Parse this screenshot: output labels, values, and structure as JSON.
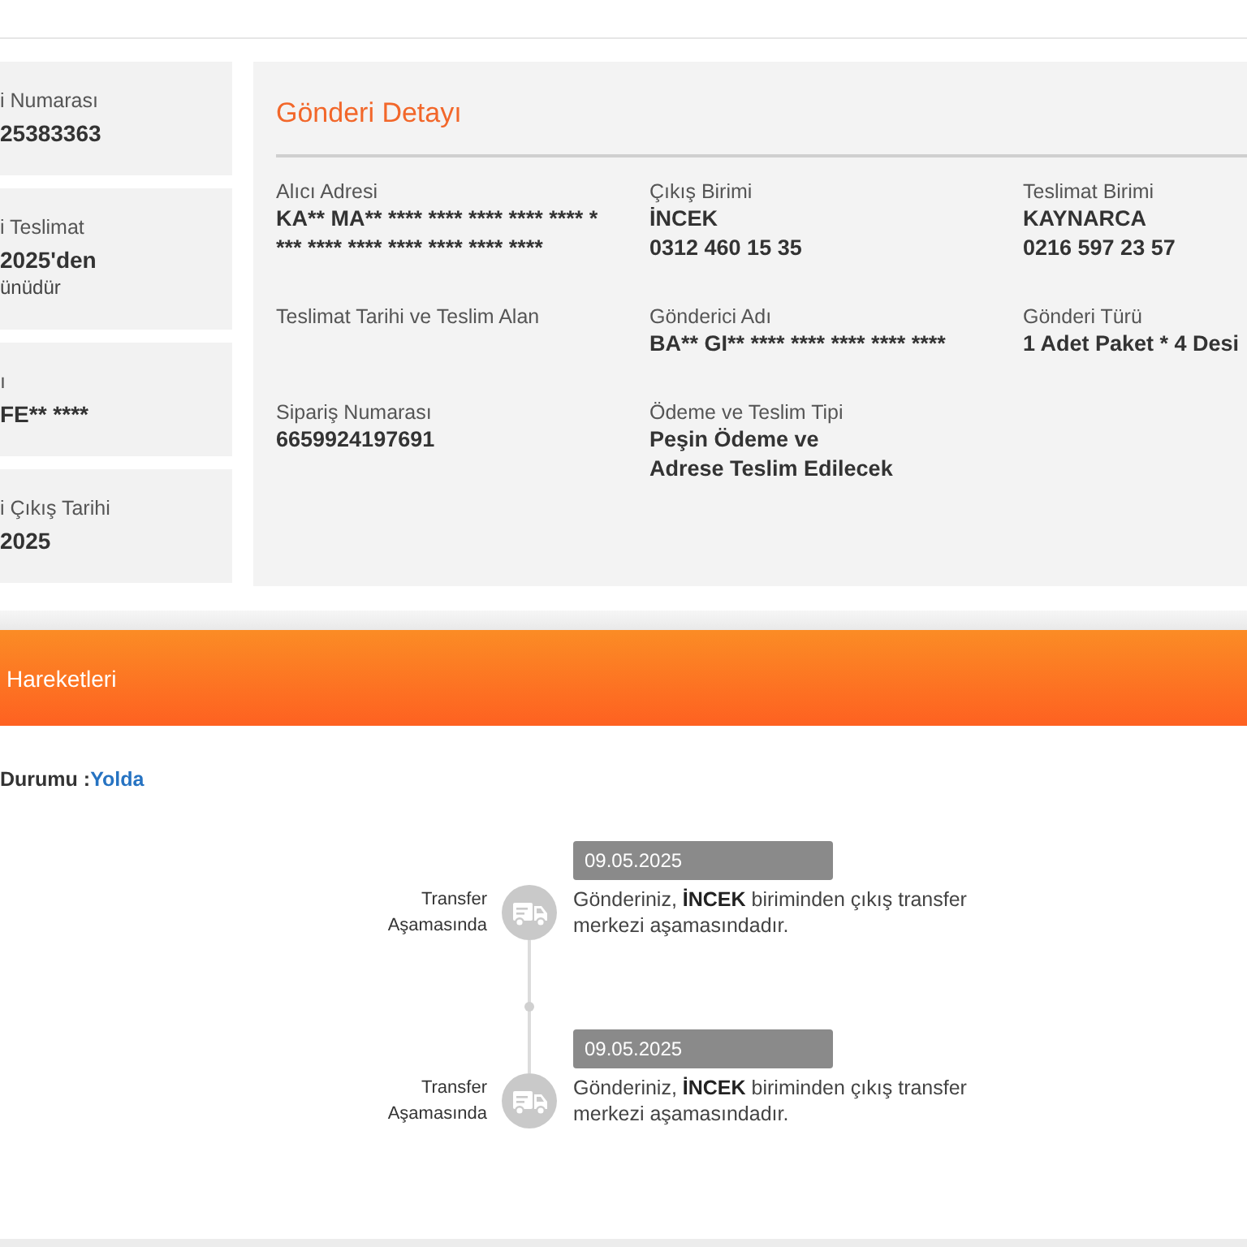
{
  "summary_cards": [
    {
      "label": "i Numarası",
      "value": "25383363"
    },
    {
      "label": "i Teslimat",
      "value": "2025'den",
      "note": "ünüdür"
    },
    {
      "label": "ı",
      "value": "FE** ****"
    },
    {
      "label": "i Çıkış Tarihi",
      "value": "2025"
    }
  ],
  "shipment_detail": {
    "title": "Gönderi Detayı",
    "fields": [
      {
        "label": "Alıcı Adresi",
        "value_lines": [
          "KA** MA** **** **** **** **** **** *",
          "*** **** **** **** **** **** ****"
        ]
      },
      {
        "label": "Çıkış Birimi",
        "value_lines": [
          "İNCEK",
          "0312 460 15 35"
        ]
      },
      {
        "label": "Teslimat Birimi",
        "value_lines": [
          "KAYNARCA",
          "0216 597 23 57"
        ]
      },
      {
        "label": "Teslimat Tarihi ve Teslim Alan"
      },
      {
        "label": "Gönderici Adı",
        "value_lines": [
          "BA** GI** **** **** **** **** ****"
        ]
      },
      {
        "label": "Gönderi Türü",
        "value_lines": [
          "1 Adet Paket * 4 Desi"
        ]
      },
      {
        "label": "Sipariş Numarası",
        "value_lines": [
          "6659924197691"
        ]
      },
      {
        "label": "Ödeme ve Teslim Tipi",
        "value_lines": [
          "Peşin Ödeme ve",
          "Adrese Teslim Edilecek"
        ]
      }
    ]
  },
  "movements": {
    "title": "Hareketleri",
    "status_label": "Durumu :",
    "status_value": "Yolda",
    "events": [
      {
        "date": "09.05.2025",
        "stage": "Transfer Aşamasında",
        "description": "Gönderiniz, **İNCEK** biriminden çıkış transfer merkezi aşamasındadır."
      },
      {
        "date": "09.05.2025",
        "stage": "Transfer Aşamasında",
        "description": "Gönderiniz, **İNCEK** biriminden çıkış transfer merkezi aşamasındadır."
      }
    ]
  }
}
